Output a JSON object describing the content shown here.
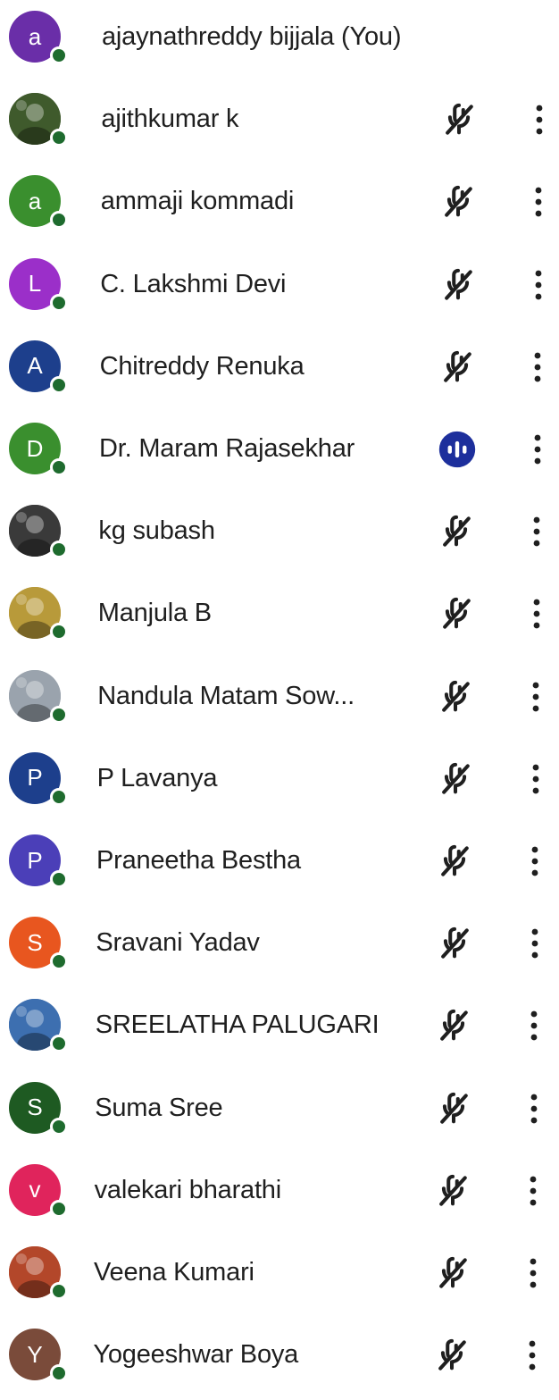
{
  "participants": [
    {
      "name": "ajaynathreddy bijjala (You)",
      "initial": "a",
      "avatar_color": "#6a2ea8",
      "avatar_type": "letter",
      "mic": "none",
      "more": false
    },
    {
      "name": "ajithkumar k",
      "initial": "",
      "avatar_color": "#3f5a2c",
      "avatar_type": "photo",
      "mic": "muted",
      "more": true
    },
    {
      "name": "ammaji kommadi",
      "initial": "a",
      "avatar_color": "#3a8f2e",
      "avatar_type": "letter",
      "mic": "muted",
      "more": true
    },
    {
      "name": "C. Lakshmi Devi",
      "initial": "L",
      "avatar_color": "#9b2fc9",
      "avatar_type": "letter",
      "mic": "muted",
      "more": true
    },
    {
      "name": "Chitreddy Renuka",
      "initial": "A",
      "avatar_color": "#1d3f8c",
      "avatar_type": "letter",
      "mic": "muted",
      "more": true
    },
    {
      "name": "Dr. Maram Rajasekhar",
      "initial": "D",
      "avatar_color": "#3a8f2e",
      "avatar_type": "letter",
      "mic": "speaking",
      "more": true
    },
    {
      "name": "kg subash",
      "initial": "",
      "avatar_color": "#3a3a3a",
      "avatar_type": "photo",
      "mic": "muted",
      "more": true
    },
    {
      "name": "Manjula B",
      "initial": "",
      "avatar_color": "#b89a3a",
      "avatar_type": "photo",
      "mic": "muted",
      "more": true
    },
    {
      "name": "Nandula Matam Sow...",
      "initial": "",
      "avatar_color": "#9aa3ad",
      "avatar_type": "photo",
      "mic": "muted",
      "more": true
    },
    {
      "name": "P Lavanya",
      "initial": "P",
      "avatar_color": "#1d3f8c",
      "avatar_type": "letter",
      "mic": "muted",
      "more": true
    },
    {
      "name": "Praneetha Bestha",
      "initial": "P",
      "avatar_color": "#4b3fb8",
      "avatar_type": "letter",
      "mic": "muted",
      "more": true
    },
    {
      "name": "Sravani Yadav",
      "initial": "S",
      "avatar_color": "#e8561f",
      "avatar_type": "letter",
      "mic": "muted",
      "more": true
    },
    {
      "name": "SREELATHA PALUGARI",
      "initial": "",
      "avatar_color": "#3d6fb0",
      "avatar_type": "photo",
      "mic": "muted",
      "more": true
    },
    {
      "name": "Suma Sree",
      "initial": "S",
      "avatar_color": "#1e5a22",
      "avatar_type": "letter",
      "mic": "muted",
      "more": true
    },
    {
      "name": "valekari bharathi",
      "initial": "v",
      "avatar_color": "#e0245c",
      "avatar_type": "letter",
      "mic": "muted",
      "more": true
    },
    {
      "name": "Veena Kumari",
      "initial": "",
      "avatar_color": "#b3472a",
      "avatar_type": "photo",
      "mic": "muted",
      "more": true
    },
    {
      "name": "Yogeeshwar Boya",
      "initial": "Y",
      "avatar_color": "#7a4b3a",
      "avatar_type": "letter",
      "mic": "muted",
      "more": true
    }
  ],
  "colors": {
    "online": "#1e6b2e",
    "icon": "#1f1f1f",
    "speaking": "#1d2f9c"
  },
  "icons": {
    "muted": "mic-off-icon",
    "speaking": "audio-level-icon",
    "more": "more-vert-icon"
  }
}
